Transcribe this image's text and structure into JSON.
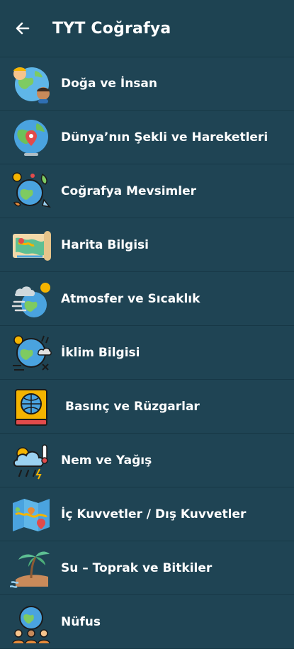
{
  "appbar": {
    "title": "TYT Coğrafya",
    "back_icon": "arrow-left-icon"
  },
  "topics": [
    {
      "label": "Doğa ve İnsan",
      "icon": "people-globe-icon"
    },
    {
      "label": "Dünya’nın Şekli ve Hareketleri",
      "icon": "globe-pin-icon"
    },
    {
      "label": "Coğrafya Mevsimler",
      "icon": "seasons-globe-icon"
    },
    {
      "label": "Harita Bilgisi",
      "icon": "map-scroll-icon"
    },
    {
      "label": "Atmosfer ve Sıcaklık",
      "icon": "cloud-globe-icon"
    },
    {
      "label": "İklim Bilgisi",
      "icon": "climate-globe-icon"
    },
    {
      "label": "Basınç ve Rüzgarlar",
      "icon": "atlas-book-icon"
    },
    {
      "label": "Nem ve Yağış",
      "icon": "rain-cloud-icon"
    },
    {
      "label": "İç Kuvvetler / Dış Kuvvetler",
      "icon": "folded-map-icon"
    },
    {
      "label": "Su – Toprak ve Bitkiler",
      "icon": "palm-island-icon"
    },
    {
      "label": "Nüfus",
      "icon": "population-globe-icon"
    }
  ]
}
